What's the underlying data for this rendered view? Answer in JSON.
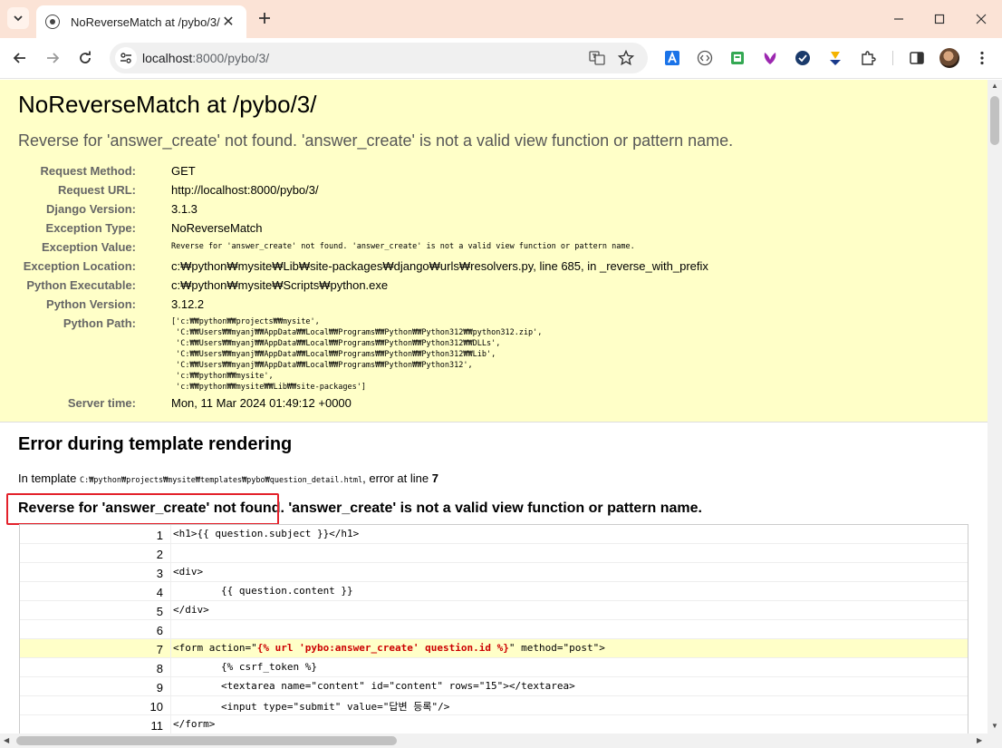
{
  "browser": {
    "tab_title": "NoReverseMatch at /pybo/3/",
    "url_host": "localhost",
    "url_path": ":8000/pybo/3/"
  },
  "summary": {
    "title": "NoReverseMatch at /pybo/3/",
    "subtitle": "Reverse for 'answer_create' not found. 'answer_create' is not a valid view function or pattern name.",
    "rows": [
      {
        "key": "Request Method:",
        "value": "GET"
      },
      {
        "key": "Request URL:",
        "value": "http://localhost:8000/pybo/3/"
      },
      {
        "key": "Django Version:",
        "value": "3.1.3"
      },
      {
        "key": "Exception Type:",
        "value": "NoReverseMatch"
      },
      {
        "key": "Exception Value:",
        "value": "Reverse for 'answer_create' not found. 'answer_create' is not a valid view function or pattern name."
      },
      {
        "key": "Exception Location:",
        "value": "c:₩python₩mysite₩Lib₩site-packages₩django₩urls₩resolvers.py, line 685, in _reverse_with_prefix"
      },
      {
        "key": "Python Executable:",
        "value": "c:₩python₩mysite₩Scripts₩python.exe"
      },
      {
        "key": "Python Version:",
        "value": "3.12.2"
      },
      {
        "key": "Python Path:",
        "value": ""
      },
      {
        "key": "Server time:",
        "value": "Mon, 11 Mar 2024 01:49:12 +0000"
      }
    ],
    "python_path": "['c:₩₩python₩₩projects₩₩mysite',\n 'C:₩₩Users₩₩myanj₩₩AppData₩₩Local₩₩Programs₩₩Python₩₩Python312₩₩python312.zip',\n 'C:₩₩Users₩₩myanj₩₩AppData₩₩Local₩₩Programs₩₩Python₩₩Python312₩₩DLLs',\n 'C:₩₩Users₩₩myanj₩₩AppData₩₩Local₩₩Programs₩₩Python₩₩Python312₩₩Lib',\n 'C:₩₩Users₩₩myanj₩₩AppData₩₩Local₩₩Programs₩₩Python₩₩Python312',\n 'c:₩₩python₩₩mysite',\n 'c:₩₩python₩₩mysite₩₩Lib₩₩site-packages']"
  },
  "template_error": {
    "title": "Error during template rendering",
    "in_template_label": "In template",
    "template_path": "C:₩python₩projects₩mysite₩templates₩pybo₩question_detail.html",
    "error_at_label": ", error at line",
    "error_line": "7",
    "message": "Reverse for 'answer_create' not found. 'answer_create' is not a valid view function or pattern name.",
    "lines": [
      {
        "no": "1",
        "code_before": "<h1>{{ question.subject }}</h1>",
        "tag": "",
        "code_after": ""
      },
      {
        "no": "2",
        "code_before": "",
        "tag": "",
        "code_after": ""
      },
      {
        "no": "3",
        "code_before": "<div>",
        "tag": "",
        "code_after": ""
      },
      {
        "no": "4",
        "code_before": "        {{ question.content }}",
        "tag": "",
        "code_after": ""
      },
      {
        "no": "5",
        "code_before": "</div>",
        "tag": "",
        "code_after": ""
      },
      {
        "no": "6",
        "code_before": "",
        "tag": "",
        "code_after": ""
      },
      {
        "no": "7",
        "code_before": "<form action=\"",
        "tag": "{% url 'pybo:answer_create' question.id %}",
        "code_after": "\" method=\"post\">"
      },
      {
        "no": "8",
        "code_before": "        {% csrf_token %}",
        "tag": "",
        "code_after": ""
      },
      {
        "no": "9",
        "code_before": "        <textarea name=\"content\" id=\"content\" rows=\"15\"></textarea>",
        "tag": "",
        "code_after": ""
      },
      {
        "no": "10",
        "code_before": "        <input type=\"submit\" value=\"답변 등록\"/>",
        "tag": "",
        "code_after": ""
      },
      {
        "no": "11",
        "code_before": "</form>",
        "tag": "",
        "code_after": ""
      }
    ]
  }
}
